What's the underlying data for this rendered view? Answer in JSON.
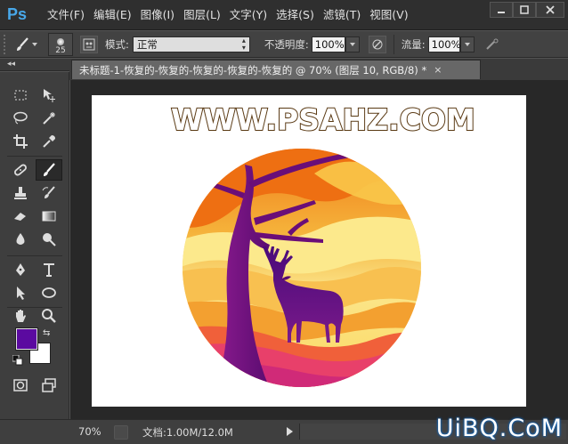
{
  "app": {
    "logo": "Ps",
    "menu": [
      "文件(F)",
      "编辑(E)",
      "图像(I)",
      "图层(L)",
      "文字(Y)",
      "选择(S)",
      "滤镜(T)",
      "视图(V)"
    ],
    "window_controls": [
      "minimize",
      "maximize",
      "close"
    ]
  },
  "options": {
    "brush_size": "25",
    "mode_label": "模式:",
    "mode_value": "正常",
    "opacity_label": "不透明度:",
    "opacity_value": "100%",
    "flow_label": "流量:",
    "flow_value": "100%"
  },
  "document": {
    "tab_title": "未标题-1-恢复的-恢复的-恢复的-恢复的-恢复的 @ 70% (图层 10, RGB/8) *",
    "tab_close": "×",
    "canvas_heading": "WWW.PSAHZ.COM"
  },
  "colors": {
    "foreground": "#5b0aa0",
    "background": "#ffffff"
  },
  "tools": [
    "rectangular-marquee-icon",
    "move-icon",
    "lasso-icon",
    "magic-wand-icon",
    "crop-icon",
    "eyedropper-icon",
    "healing-brush-icon",
    "brush-icon",
    "clone-stamp-icon",
    "history-brush-icon",
    "eraser-icon",
    "gradient-icon",
    "blur-icon",
    "dodge-icon",
    "pen-icon",
    "type-icon",
    "path-selection-icon",
    "ellipse-icon",
    "hand-icon",
    "zoom-icon",
    "quick-mask-icon",
    "screen-mode-icon"
  ],
  "status": {
    "zoom": "70%",
    "doc_size": "文档:1.00M/12.0M"
  },
  "watermark": "UiBQ.CoM"
}
